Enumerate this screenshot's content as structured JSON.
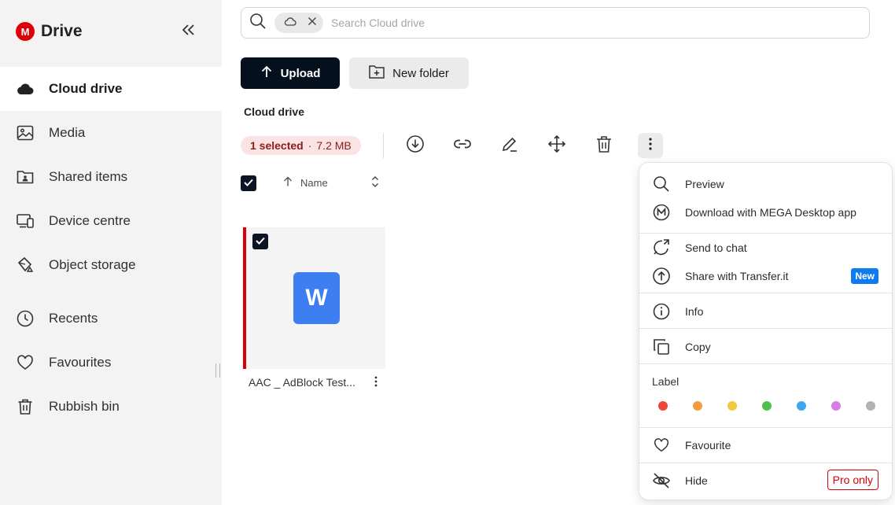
{
  "sidebar": {
    "brand": {
      "logo_letter": "M",
      "name": "Drive",
      "color": "#d90007"
    },
    "collapse_icon": "double-chevron-left-icon",
    "items": [
      {
        "label": "Cloud drive",
        "icon": "cloud-icon",
        "active": true
      },
      {
        "label": "Media",
        "icon": "image-icon"
      },
      {
        "label": "Shared items",
        "icon": "shared-folder-icon"
      },
      {
        "label": "Device centre",
        "icon": "devices-icon"
      },
      {
        "label": "Object storage",
        "icon": "bucket-icon"
      },
      {
        "label": "Recents",
        "icon": "clock-icon"
      },
      {
        "label": "Favourites",
        "icon": "heart-icon"
      },
      {
        "label": "Rubbish bin",
        "icon": "trash-icon"
      }
    ]
  },
  "search": {
    "chip_icon": "cloud-icon",
    "placeholder": "Search Cloud drive"
  },
  "actions": {
    "upload_label": "Upload",
    "new_folder_label": "New folder"
  },
  "section_title": "Cloud drive",
  "selection": {
    "count_label": "1 selected",
    "separator": "·",
    "size": "7.2 MB"
  },
  "toolbar": [
    "download-icon",
    "link-icon",
    "rename-icon",
    "move-icon",
    "trash-icon",
    "more-vertical-icon"
  ],
  "list_header": {
    "sort_label": "Name"
  },
  "file": {
    "name": "AAC _ AdBlock Test...",
    "type_letter": "W",
    "selected": true
  },
  "context_menu": {
    "preview": "Preview",
    "download_desktop": "Download with MEGA Desktop app",
    "send_to_chat": "Send to chat",
    "share_transfer": "Share with Transfer.it",
    "new_badge": "New",
    "info": "Info",
    "copy": "Copy",
    "label_title": "Label",
    "label_colors": [
      "#f04438",
      "#f79a3b",
      "#f2c83c",
      "#4cc24e",
      "#3ea6f0",
      "#d67ee3",
      "#b3b3b3"
    ],
    "favourite": "Favourite",
    "hide": "Hide",
    "pro_badge": "Pro only"
  }
}
